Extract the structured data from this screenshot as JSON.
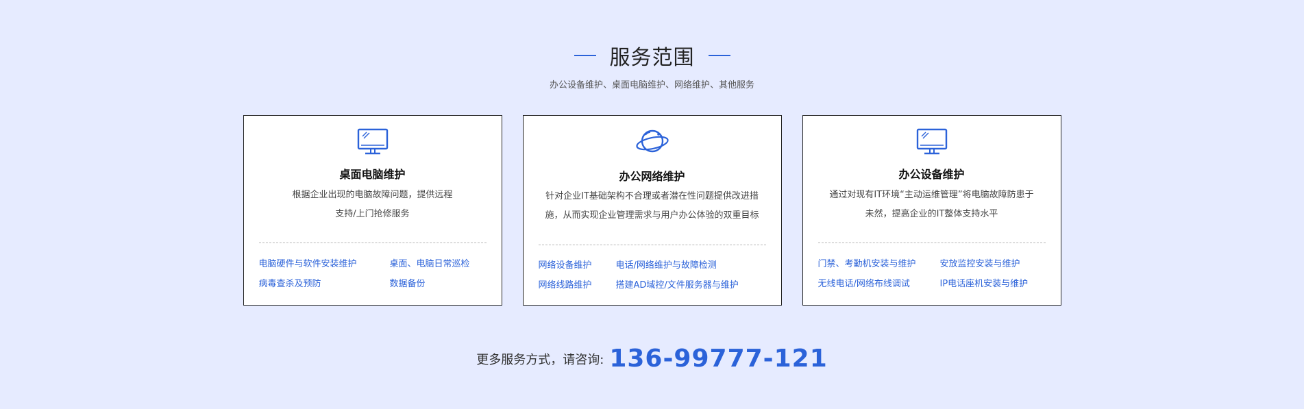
{
  "header": {
    "title": "服务范围",
    "subtitle": "办公设备维护、桌面电脑维护、网络维护、其他服务"
  },
  "cards": [
    {
      "icon": "monitor-icon",
      "title": "桌面电脑维护",
      "desc_line1": "根据企业出现的电脑故障问题，提供远程",
      "desc_line2": "支持/上门抢修服务",
      "links": [
        "电脑硬件与软件安装维护",
        "桌面、电脑日常巡检",
        "病毒查杀及预防",
        "数据备份"
      ]
    },
    {
      "icon": "planet-icon",
      "title": "办公网络维护",
      "desc_line1": "针对企业IT基础架构不合理或者潜在性问题提供改进措",
      "desc_line2": "施，从而实现企业管理需求与用户办公体验的双重目标",
      "links": [
        "网络设备维护",
        "电话/网络维护与故障检测",
        "网络线路维护",
        "搭建AD域控/文件服务器与维护"
      ]
    },
    {
      "icon": "monitor-icon",
      "title": "办公设备维护",
      "desc_line1": "通过对现有IT环境“主动运维管理”将电脑故障防患于",
      "desc_line2": "未然，提高企业的IT整体支持水平",
      "links": [
        "门禁、考勤机安装与维护",
        "安放监控安装与维护",
        "无线电话/网络布线调试",
        "IP电话座机安装与维护"
      ]
    }
  ],
  "contact": {
    "label": "更多服务方式，请咨询:",
    "phone": "136-99777-121"
  },
  "colors": {
    "accent": "#2b62d9",
    "background": "#e6ebff"
  }
}
